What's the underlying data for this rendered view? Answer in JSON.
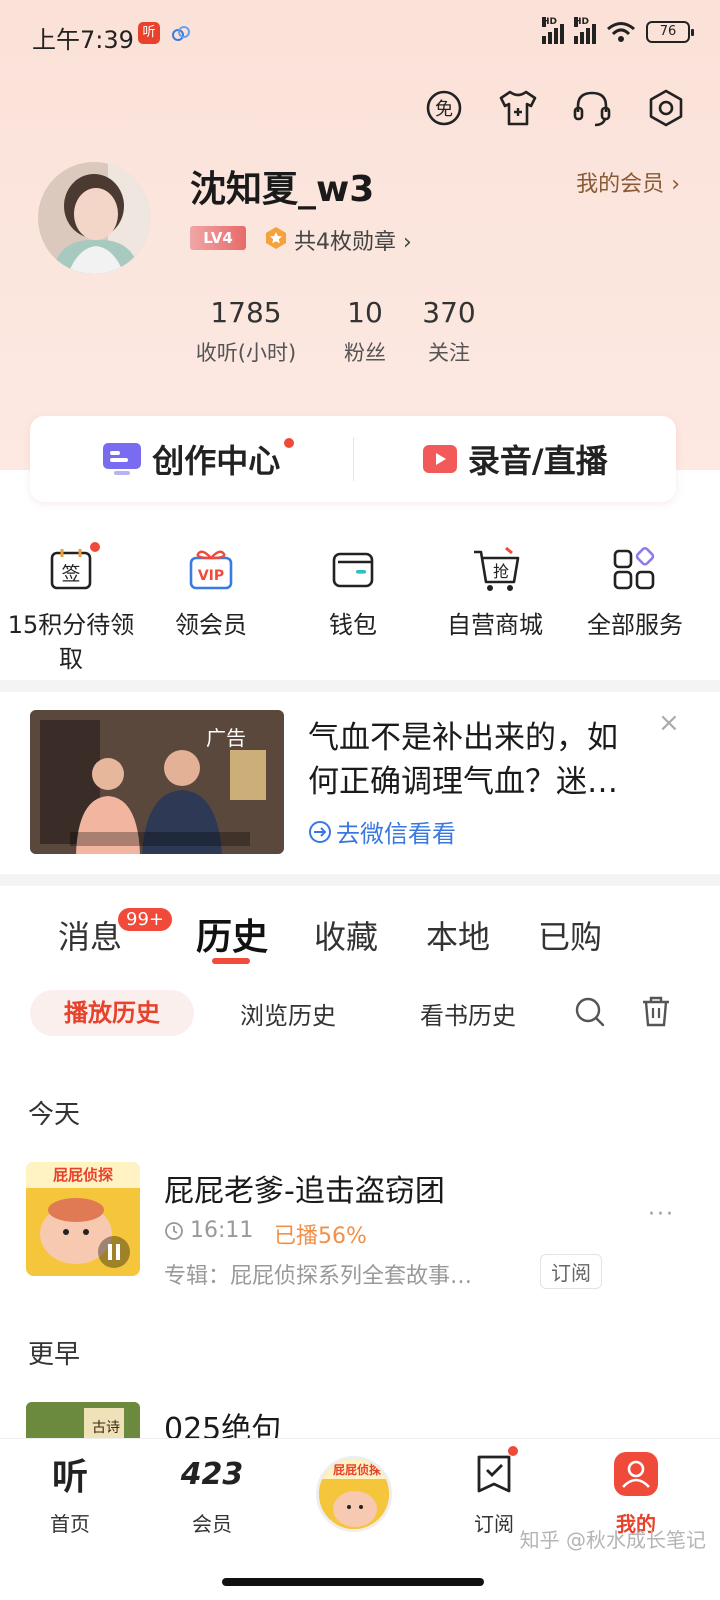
{
  "status_bar": {
    "time": "上午7:39",
    "app_badge": "听",
    "battery": "76"
  },
  "header": {
    "icons": [
      "free-icon",
      "shirt-icon",
      "headset-icon",
      "settings-icon"
    ]
  },
  "profile": {
    "username": "沈知夏_w3",
    "vip_link": "我的会员",
    "level": "LV4",
    "medals": "共4枚勋章",
    "stats": [
      {
        "value": "1785",
        "label": "收听(小时)"
      },
      {
        "value": "10",
        "label": "粉丝"
      },
      {
        "value": "370",
        "label": "关注"
      }
    ]
  },
  "creator": {
    "center_label": "创作中心",
    "record_label": "录音/直播"
  },
  "services": [
    {
      "label": "15积分待领取"
    },
    {
      "label": "领会员"
    },
    {
      "label": "钱包"
    },
    {
      "label": "自营商城"
    },
    {
      "label": "全部服务"
    }
  ],
  "ad": {
    "tag": "广告",
    "title": "气血不是补出来的，如何正确调理气血？迷…",
    "link": "去微信看看",
    "close": "×"
  },
  "tabs": {
    "items": [
      "消息",
      "历史",
      "收藏",
      "本地",
      "已购"
    ],
    "active": "历史",
    "badge": "99+"
  },
  "subtabs": {
    "items": [
      "播放历史",
      "浏览历史",
      "看书历史"
    ],
    "active": "播放历史"
  },
  "history": {
    "today_label": "今天",
    "earlier_label": "更早",
    "items": [
      {
        "title": "屁屁老爹-追击盗窃团",
        "time": "16:11",
        "progress": "已播56%",
        "album": "专辑：屁屁侦探系列全套故事…",
        "subscribe": "订阅",
        "more": "···"
      },
      {
        "title": "025绝句"
      }
    ]
  },
  "bottom_nav": {
    "items": [
      {
        "label": "首页",
        "icon_text": "听"
      },
      {
        "label": "会员",
        "icon_text": "423"
      },
      {
        "label": "订阅"
      },
      {
        "label": "我的"
      }
    ]
  },
  "watermark": "知乎 @秋水成长笔记",
  "colors": {
    "accent": "#e8412c",
    "orange": "#f0904a",
    "link": "#3a78e0",
    "vip_brown": "#8a5a35"
  }
}
